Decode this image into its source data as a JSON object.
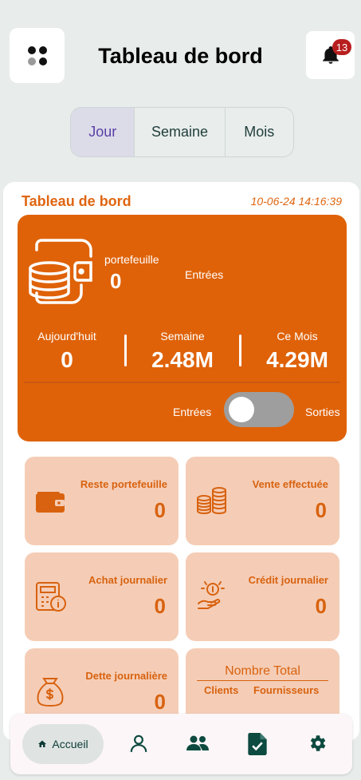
{
  "header": {
    "title": "Tableau de bord",
    "notification_count": "13"
  },
  "tabs": [
    {
      "label": "Jour",
      "active": true
    },
    {
      "label": "Semaine",
      "active": false
    },
    {
      "label": "Mois",
      "active": false
    }
  ],
  "dashboard": {
    "title": "Tableau de bord",
    "timestamp": "10-06-24 14:16:39",
    "portefeuille_label": "portefeuille",
    "portefeuille_value": "0",
    "entrees_label": "Entrées",
    "stats": [
      {
        "label": "Aujourd'huit",
        "value": "0"
      },
      {
        "label": "Semaine",
        "value": "2.48M"
      },
      {
        "label": "Ce Mois",
        "value": "4.29M"
      }
    ],
    "toggle_left": "Entrées",
    "toggle_right": "Sorties"
  },
  "tiles": [
    {
      "label": "Reste portefeuille",
      "value": "0",
      "icon": "wallet-icon"
    },
    {
      "label": "Vente effectuée",
      "value": "0",
      "icon": "coins-icon"
    },
    {
      "label": "Achat journalier",
      "value": "0",
      "icon": "calculator-icon"
    },
    {
      "label": "Crédit journalier",
      "value": "0",
      "icon": "hand-coin-icon"
    },
    {
      "label": "Dette journalière",
      "value": "0",
      "icon": "money-bag-icon"
    }
  ],
  "nombre_total": {
    "title": "Nombre Total",
    "clients_label": "Clients",
    "fournisseurs_label": "Fournisseurs"
  },
  "nav": {
    "home_label": "Accueil"
  },
  "colors": {
    "accent": "#df6208",
    "tile_bg": "#f5cdb6",
    "nav_icon": "#0d4a40"
  }
}
